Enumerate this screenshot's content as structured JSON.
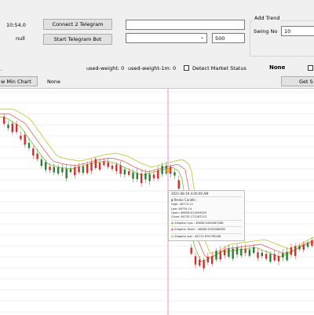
{
  "top": {
    "time_value": "10:54.0",
    "null_label": "null",
    "connect_button": "Connect 2 Telegram",
    "start_bot_button": "Start Telegram Bot",
    "telegram_input": "",
    "select_value": "",
    "number_input": "500"
  },
  "trend": {
    "title": "Add Trend",
    "swing_label": "Swing No",
    "swing_value": "10"
  },
  "status": {
    "used_weight": "used-weight: 0",
    "used_weight_1m": "used-weight-1m: 0",
    "detect_label": "Detect Market Status",
    "market_status": "None",
    "min_chart_button": "w Min Chart",
    "none_label": "None",
    "get_button": "Get S"
  },
  "tooltip": {
    "time": "2021-08-19 4:00:00 AM",
    "candle_title": "Renko Candle :",
    "high": "High: 46773.12",
    "low": "Low: 46704.14",
    "open": "Open: 46636.611894559",
    "close": "Close: 46735.171267212",
    "lips": "Alligator Lips : 46608.0446487588",
    "teeth": "Alligator Teeth : 46666.5059986985",
    "jaw": "Alligator Jaw : 46713.876798268"
  },
  "colors": {
    "up": "#2e7d32",
    "down": "#d32f2f",
    "lips": "#8bc34a",
    "teeth": "#e57373",
    "jaw": "#c8c84a",
    "crosshair": "#e07bd8"
  }
}
